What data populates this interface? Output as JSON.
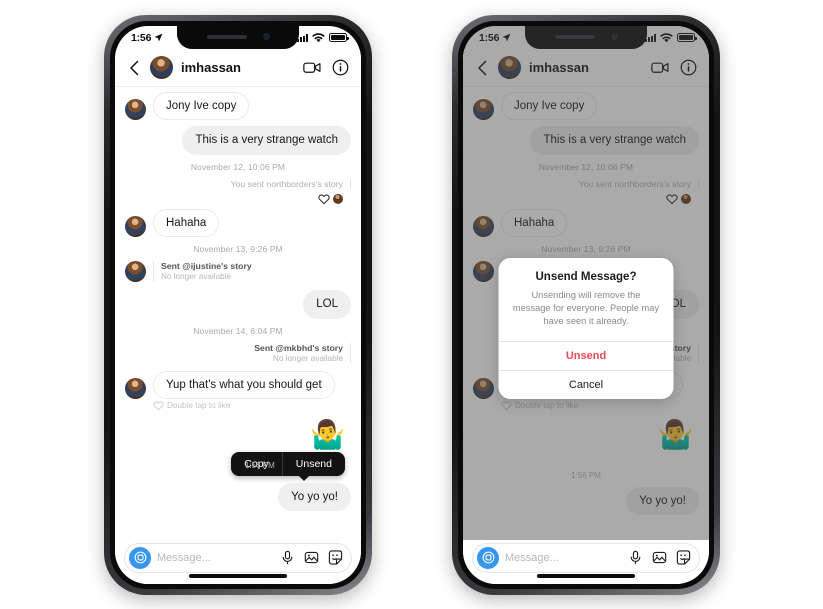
{
  "status_bar": {
    "time": "1:56",
    "location_icon": "location-arrow-icon",
    "signal_icon": "cellular-signal-icon",
    "wifi_icon": "wifi-icon",
    "battery_icon": "battery-full-icon"
  },
  "nav": {
    "back_icon": "chevron-left-icon",
    "title": "imhassan",
    "video_icon": "video-camera-icon",
    "info_icon": "info-circle-icon"
  },
  "thread": {
    "m1": "Jony Ive copy",
    "m2": "This is a very strange watch",
    "day1": "November 12, 10:06 PM",
    "story1": "You sent northborders's story",
    "m3": "Hahaha",
    "day2": "November 13, 9:26 PM",
    "story2_sent": "Sent @ijustine's story",
    "story2_na": "No longer available",
    "m4": "LOL",
    "day3": "November 14, 6:04 PM",
    "story3_sent": "Sent @mkbhd's story",
    "story3_na": "No longer available",
    "m5": "Yup that's what you should get",
    "double_tap": "Double tap to like",
    "emoji": "🤷‍♂️",
    "msg_time": "1:56 PM",
    "m6": "Yo yo yo!"
  },
  "context_menu": {
    "copy": "Copy",
    "unsend": "Unsend"
  },
  "input_bar": {
    "camera_icon": "camera-icon",
    "placeholder": "Message...",
    "mic_icon": "microphone-icon",
    "photo_icon": "photo-icon",
    "sticker_icon": "sticker-icon"
  },
  "alert": {
    "title": "Unsend Message?",
    "message": "Unsending will remove the message for everyone. People may have seen it already.",
    "confirm": "Unsend",
    "cancel": "Cancel",
    "confirm_color": "#ED4956"
  }
}
